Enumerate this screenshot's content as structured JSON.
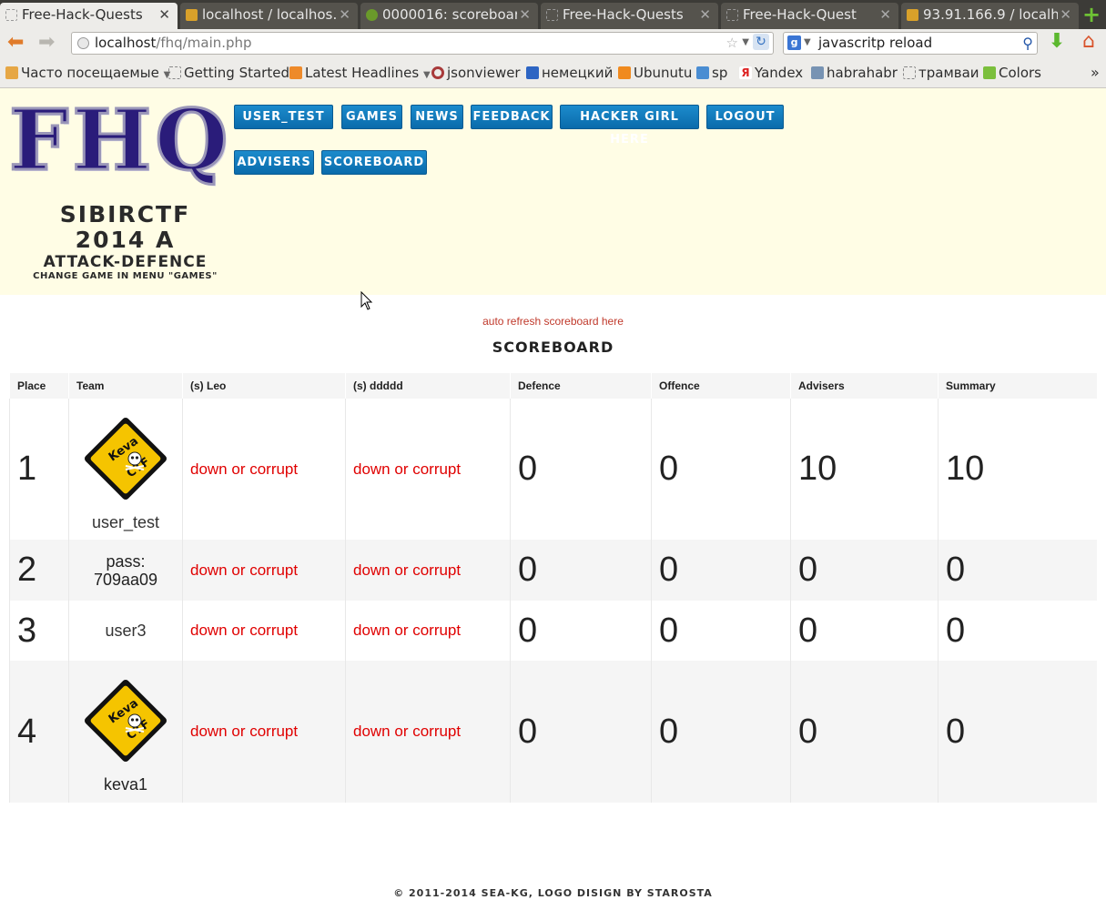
{
  "browser": {
    "tabs": [
      {
        "title": "Free-Hack-Quests",
        "active": true
      },
      {
        "title": "localhost / localhos…",
        "active": false
      },
      {
        "title": "0000016: scoreboar…",
        "active": false
      },
      {
        "title": "Free-Hack-Quests",
        "active": false
      },
      {
        "title": "Free-Hack-Quest",
        "active": false
      },
      {
        "title": "93.91.166.9 / localh…",
        "active": false
      }
    ],
    "url_host": "localhost",
    "url_path": "/fhq/main.php",
    "search_value": "javascritp reload",
    "bookmarks": [
      "Часто посещаемые",
      "Getting Started",
      "Latest Headlines",
      "jsonviewer",
      "немецкий",
      "Ubunutu",
      "sp",
      "Yandex",
      "habrahabr",
      "трамваи",
      "Colors"
    ]
  },
  "header": {
    "logo_text": "FHQ",
    "game_name_1": "SIBIRCTF",
    "game_name_2": "2014 A",
    "game_type": "ATTACK-DEFENCE",
    "game_hint": "CHANGE GAME IN MENU \"GAMES\"",
    "menu": [
      "USER_TEST",
      "GAMES",
      "NEWS",
      "FEEDBACK",
      "HACKER GIRL HERE",
      "LOGOUT",
      "ADVISERS",
      "SCOREBOARD"
    ]
  },
  "main": {
    "refresh_link": "auto refresh scoreboard here",
    "title": "SCOREBOARD",
    "columns": [
      "Place",
      "Team",
      "(s) Leo",
      "(s) ddddd",
      "Defence",
      "Offence",
      "Advisers",
      "Summary"
    ],
    "rows": [
      {
        "place": "1",
        "team": "user_test",
        "logo": true,
        "leo": "down or corrupt",
        "ddddd": "down or corrupt",
        "defence": "0",
        "offence": "0",
        "advisers": "10",
        "summary": "10"
      },
      {
        "place": "2",
        "team": "pass: 709aa09",
        "logo": false,
        "leo": "down or corrupt",
        "ddddd": "down or corrupt",
        "defence": "0",
        "offence": "0",
        "advisers": "0",
        "summary": "0"
      },
      {
        "place": "3",
        "team": "user3",
        "logo": false,
        "leo": "down or corrupt",
        "ddddd": "down or corrupt",
        "defence": "0",
        "offence": "0",
        "advisers": "0",
        "summary": "0"
      },
      {
        "place": "4",
        "team": "keva1",
        "logo": true,
        "leo": "down or corrupt",
        "ddddd": "down or corrupt",
        "defence": "0",
        "offence": "0",
        "advisers": "0",
        "summary": "0"
      }
    ],
    "team_logo_text_1": "Keva",
    "team_logo_text_2": "CTF"
  },
  "footer": {
    "text": "© 2011-2014 SEA-KG, LOGO DISIGN BY STAROSTA"
  },
  "colors": {
    "header_bg": "#fffde5",
    "menu_button": "#0a6bab",
    "status_red": "#e00000",
    "logo_yellow": "#f5c400"
  }
}
